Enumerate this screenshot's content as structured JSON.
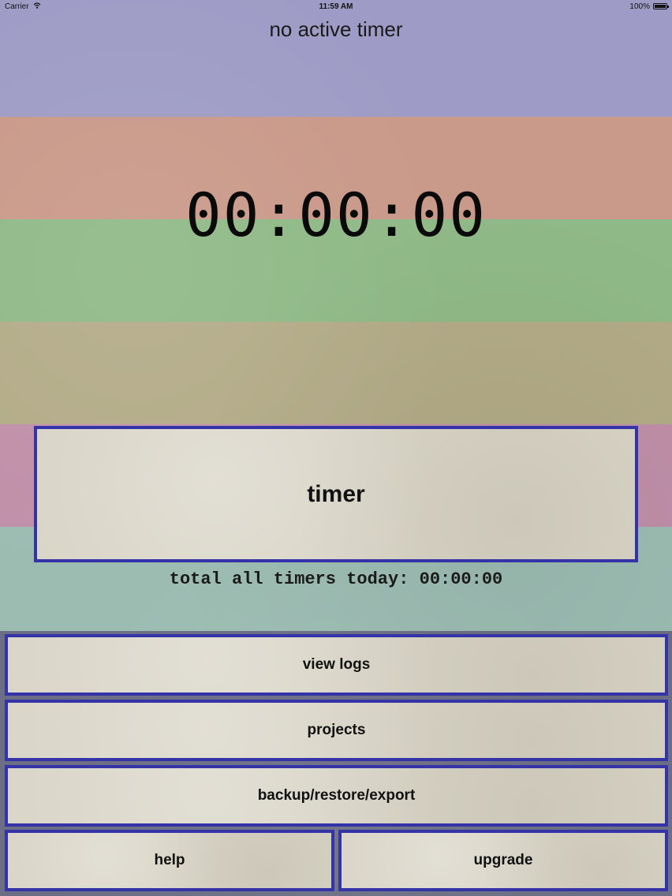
{
  "status_bar": {
    "carrier": "Carrier",
    "time": "11:59 AM",
    "battery": "100%"
  },
  "header": {
    "timer_status": "no active timer"
  },
  "clock": {
    "display": "00:00:00"
  },
  "timer_button": {
    "label": "timer"
  },
  "summary": {
    "total_today": "total all timers today: 00:00:00"
  },
  "menu": {
    "view_logs": "view logs",
    "projects": "projects",
    "backup": "backup/restore/export",
    "help": "help",
    "upgrade": "upgrade"
  },
  "colors": {
    "band_purple": "#9e9cc6",
    "band_red": "#c99989",
    "band_green": "#8fb986",
    "band_olive": "#b3ab87",
    "band_pink": "#c08fa9",
    "band_teal": "#9cbcb2",
    "button_border": "#3434a8",
    "button_paper": "#d8d4c6"
  }
}
